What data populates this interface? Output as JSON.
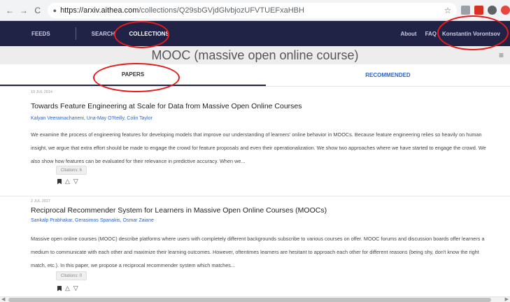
{
  "browser": {
    "url_host": "https://arxiv.aithea.com",
    "url_path": "/collections/Q29sbGVjdGlvbjozUFVTUEFxaHBH"
  },
  "topnav": {
    "feeds": "FEEDS",
    "search": "SEARCH",
    "collections": "COLLECTIONS",
    "about": "About",
    "faq": "FAQ",
    "user": "Konstantin Vorontsov"
  },
  "collection": {
    "title": "MOOC (massive open online course)"
  },
  "tabs": [
    {
      "label": "PAPERS",
      "active": true
    },
    {
      "label": "RECOMMENDED",
      "active": false
    }
  ],
  "papers": [
    {
      "date": "19 JUL 2014",
      "title": "Towards Feature Engineering at Scale for Data from Massive Open Online Courses",
      "authors": "Kalyan Veeramachaneni, Una-May O'Reilly, Colin Taylor",
      "abstract": "We examine the process of engineering features for developing models that improve our understanding of learners' online behavior in MOOCs. Because feature engineering relies so heavily on human insight, we argue that extra effort should be made to engage the crowd for feature proposals and even their operationalization. We show two approaches where we have started to engage the crowd. We also show how features can be evaluated for their relevance in predictive accuracy. When we...",
      "citations": "Citations: 6"
    },
    {
      "date": "2 JUL 2017",
      "title": "Reciprocal Recommender System for Learners in Massive Open Online Courses (MOOCs)",
      "authors": "Sankalp Prabhakar, Gerasimos Spanakis, Osmar Zaiane",
      "abstract": "Massive open online courses (MOOC) describe platforms where users with completely different backgrounds subscribe to various courses on offer. MOOC forums and discussion boards offer learners a medium to communicate with each other and maximize their learning outcomes. However, oftentimes learners are hesitant to approach each other for different reasons (being shy, don't know the right match, etc.). In this paper, we propose a reciprocal recommender system which matches...",
      "citations": "Citations: 0"
    }
  ],
  "icons": {
    "back": "←",
    "forward": "→",
    "reload": "C",
    "lock": "🔒",
    "star": "☆",
    "settings": "≡",
    "thumbs_up": "👍",
    "thumbs_down": "👎"
  },
  "colors": {
    "nav_bg": "#202346",
    "link_blue": "#2e63c9",
    "annotation_red": "#e51b1b"
  }
}
